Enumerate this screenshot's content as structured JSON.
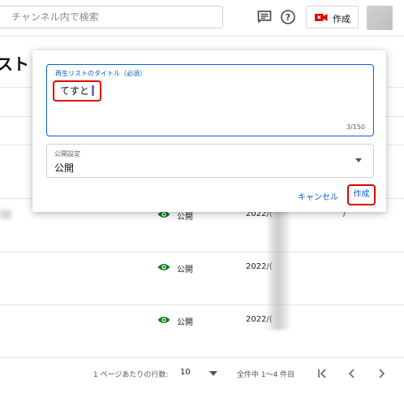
{
  "header": {
    "search_placeholder": "チャンネル内で検索",
    "icons": [
      "feedback-icon",
      "help-icon"
    ],
    "create_label": "作成",
    "accent_color": "#e00000"
  },
  "page": {
    "title_fragment": "スト"
  },
  "rows": [
    {
      "visibility": "公開",
      "date": "2022/("
    },
    {
      "visibility": "公開",
      "date": "2022/("
    },
    {
      "visibility": "公開",
      "date": "2022/("
    }
  ],
  "row_tail": "/",
  "footer": {
    "rows_per_page_label": "1 ページあたりの行数:",
    "rows_per_page_value": "10",
    "range_text": "全件中 1〜4 件目"
  },
  "dialog": {
    "title_label": "再生リストのタイトル（必須）",
    "title_value": "てすと",
    "char_counter": "3/150",
    "visibility_label": "公開設定",
    "visibility_value": "公開",
    "cancel_label": "キャンセル",
    "create_label": "作成",
    "link_color": "#065fd4"
  }
}
